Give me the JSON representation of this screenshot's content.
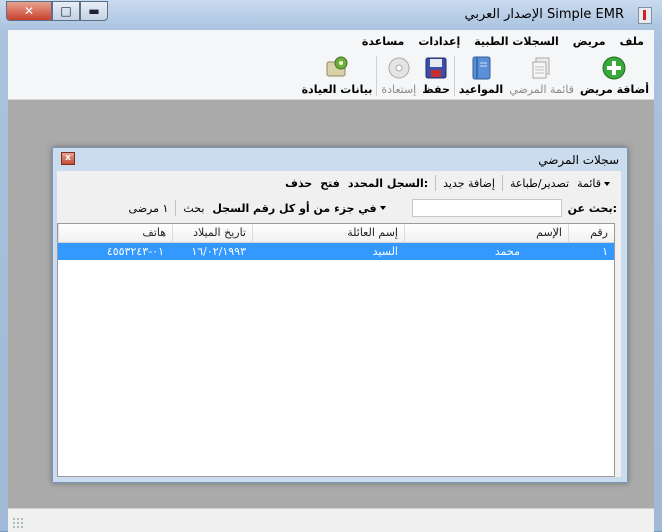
{
  "window": {
    "title": "Simple EMR الإصدار العربي",
    "close_glyph": "✕",
    "max_glyph": "□",
    "min_glyph": "▬"
  },
  "menu": [
    "ملف",
    "مريض",
    "السجلات الطبية",
    "إعدادات",
    "مساعدة"
  ],
  "toolbar": {
    "add_patient": "أضافة مريض",
    "patient_list": "قائمة المرضي",
    "appointments": "المواعيد",
    "save": "حفظ",
    "restore": "إستعادة",
    "clinic_data": "بيانات العيادة"
  },
  "child": {
    "title": "سجلات المرضي",
    "close_glyph": "x",
    "commands": {
      "list": "قائمة",
      "export_print": "تصدير/طباعة",
      "add_new": "إضافة جديد",
      "selected_record": "السجل المحدد:",
      "open": "فتح",
      "delete": "حذف"
    },
    "search": {
      "label": "بحث عن:",
      "value": "",
      "scope": "في جزء من أو كل رقم السجل",
      "button": "بحث",
      "count": "١ مرضى"
    },
    "columns": {
      "number": "رقم",
      "name": "الإسم",
      "family": "إسم العائلة",
      "birthdate": "تاريخ الميلاد",
      "phone": "هاتف"
    },
    "rows": [
      {
        "number": "١",
        "name": "محمد",
        "family": "السيد",
        "birthdate": "١٦/٠٢/١٩٩٣",
        "phone": "٠١-٤٥٥٣٢٤٣"
      }
    ]
  },
  "colors": {
    "selection": "#3399ff",
    "mdi_background": "#aaaaaa"
  }
}
